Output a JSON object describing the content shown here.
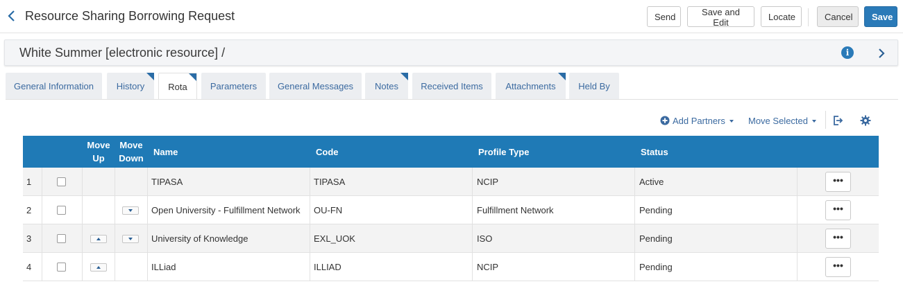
{
  "header": {
    "title": "Resource Sharing Borrowing Request",
    "buttons": {
      "send": "Send",
      "save_and_edit": "Save and Edit",
      "locate": "Locate",
      "cancel": "Cancel",
      "save": "Save"
    }
  },
  "record": {
    "title": "White Summer [electronic resource] /",
    "info_glyph": "i"
  },
  "tabs": [
    {
      "label": "General Information",
      "active": false,
      "has_content": false
    },
    {
      "label": "History",
      "active": false,
      "has_content": true
    },
    {
      "label": "Rota",
      "active": true,
      "has_content": true
    },
    {
      "label": "Parameters",
      "active": false,
      "has_content": false
    },
    {
      "label": "General Messages",
      "active": false,
      "has_content": false
    },
    {
      "label": "Notes",
      "active": false,
      "has_content": true
    },
    {
      "label": "Received Items",
      "active": false,
      "has_content": false
    },
    {
      "label": "Attachments",
      "active": false,
      "has_content": true
    },
    {
      "label": "Held By",
      "active": false,
      "has_content": false
    }
  ],
  "toolbar": {
    "add_partners": "Add Partners",
    "move_selected": "Move Selected"
  },
  "table": {
    "columns": {
      "move_up_1": "Move",
      "move_up_2": "Up",
      "move_down_1": "Move",
      "move_down_2": "Down",
      "name": "Name",
      "code": "Code",
      "profile_type": "Profile Type",
      "status": "Status"
    },
    "rows": [
      {
        "index": "1",
        "name": "TIPASA",
        "code": "TIPASA",
        "profile_type": "NCIP",
        "status": "Active",
        "can_move_up": false,
        "can_move_down": false
      },
      {
        "index": "2",
        "name": "Open University - Fulfillment Network",
        "code": "OU-FN",
        "profile_type": "Fulfillment Network",
        "status": "Pending",
        "can_move_up": false,
        "can_move_down": true
      },
      {
        "index": "3",
        "name": "University of Knowledge",
        "code": "EXL_UOK",
        "profile_type": "ISO",
        "status": "Pending",
        "can_move_up": true,
        "can_move_down": true
      },
      {
        "index": "4",
        "name": "ILLiad",
        "code": "ILLIAD",
        "profile_type": "NCIP",
        "status": "Pending",
        "can_move_up": true,
        "can_move_down": false
      }
    ],
    "row_action_glyph": "•••"
  },
  "colors": {
    "accent": "#2a7ab8",
    "header_bg": "#1f7ab6",
    "link": "#3b6aa0"
  }
}
